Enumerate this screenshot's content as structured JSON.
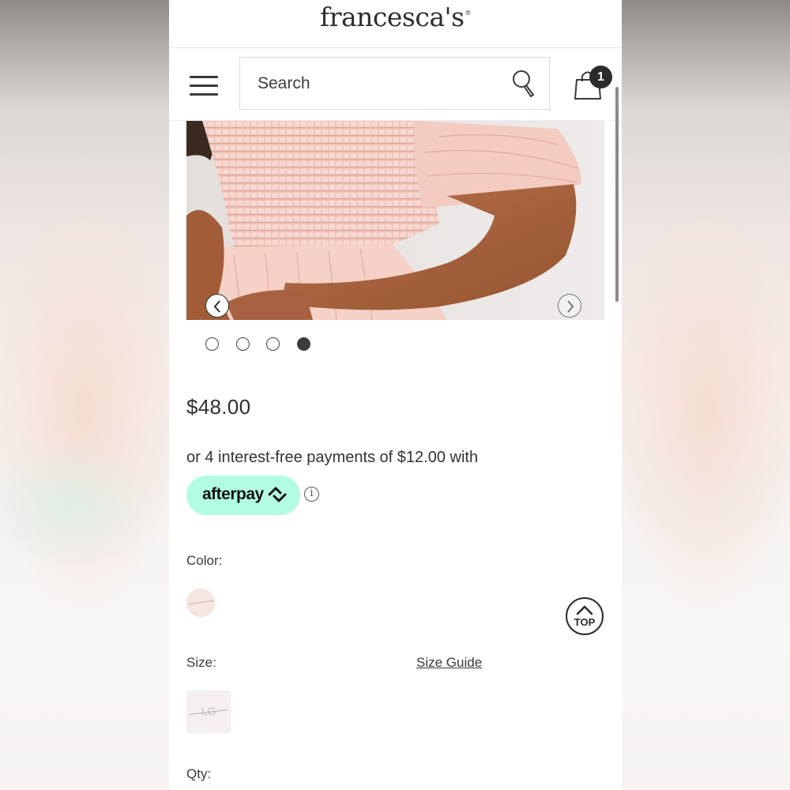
{
  "header": {
    "logo": "francesca's",
    "logo_mark": "®"
  },
  "nav": {
    "menu_icon": "hamburger-menu-icon",
    "search_placeholder": "Search",
    "search_icon": "search-icon",
    "cart_icon": "shopping-bag-icon",
    "cart_count": "1"
  },
  "carousel": {
    "prev_icon": "chevron-left-icon",
    "next_icon": "chevron-right-icon",
    "slide_count": 4,
    "active_index": 3
  },
  "product": {
    "price": "$48.00",
    "installment_text": "or 4 interest-free payments of $12.00 with",
    "afterpay_label": "afterpay",
    "afterpay_color": "#b2fce4",
    "info_symbol": "i",
    "color_label": "Color:",
    "size_label": "Size:",
    "size_guide_label": "Size Guide",
    "size_options": [
      "LG"
    ],
    "qty_label": "Qty:"
  },
  "back_to_top": {
    "label": "TOP",
    "icon": "chevron-up-icon"
  }
}
